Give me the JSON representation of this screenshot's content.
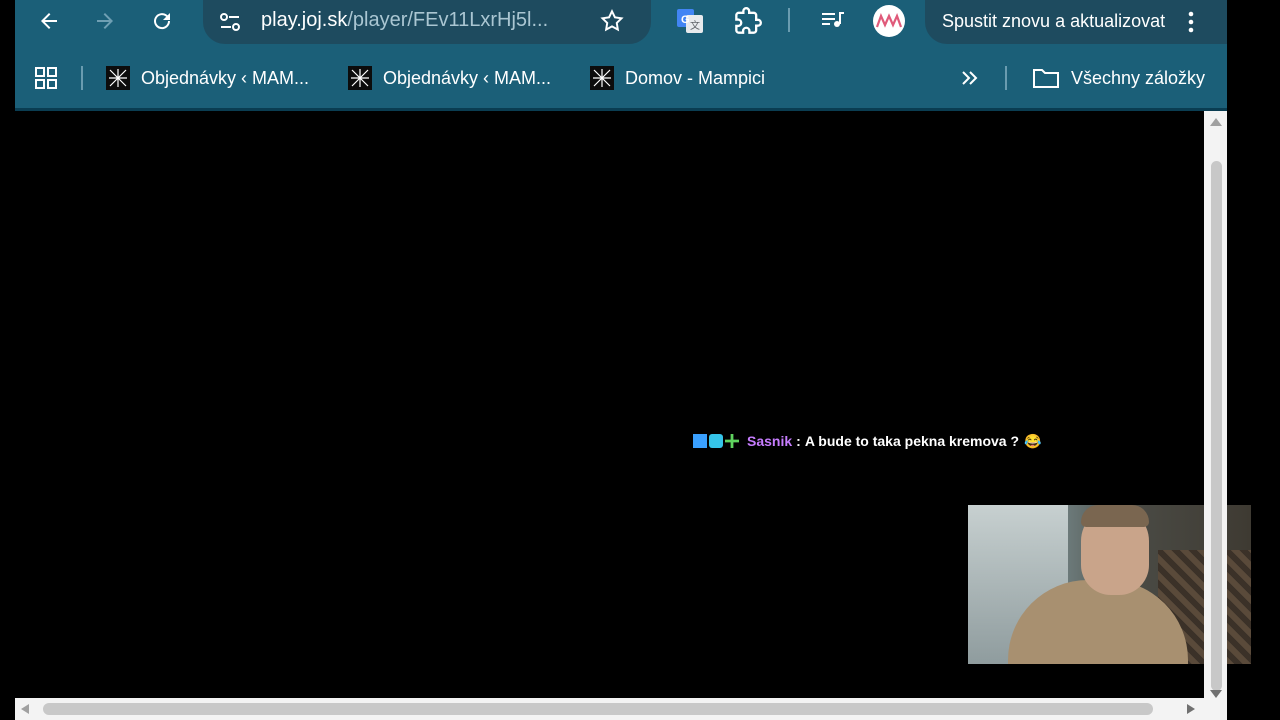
{
  "browser": {
    "url_host": "play.joj.sk",
    "url_path": "/player/FEv11LxrHj5l...",
    "update_button_label": "Spustit znovu a aktualizovat",
    "colors": {
      "toolbar": "#1b5f78",
      "omnibox": "#1e4b5f"
    }
  },
  "bookmarks": {
    "items": [
      {
        "label": "Objednávky ‹ MAM..."
      },
      {
        "label": "Objednávky ‹ MAM..."
      },
      {
        "label": "Domov - Mampici"
      }
    ],
    "all_bookmarks_label": "Všechny záložky"
  },
  "chat": {
    "username": "Sasnik",
    "separator": ":",
    "message": "A bude to taka pekna kremova ?",
    "emoji": "😂"
  },
  "icons": [
    "back-icon",
    "forward-icon",
    "reload-icon",
    "site-settings-icon",
    "star-icon",
    "google-translate-icon",
    "extensions-icon",
    "media-control-icon",
    "profile-avatar-icon",
    "more-vert-icon",
    "apps-grid-icon",
    "chevron-double-right-icon",
    "folder-icon"
  ]
}
